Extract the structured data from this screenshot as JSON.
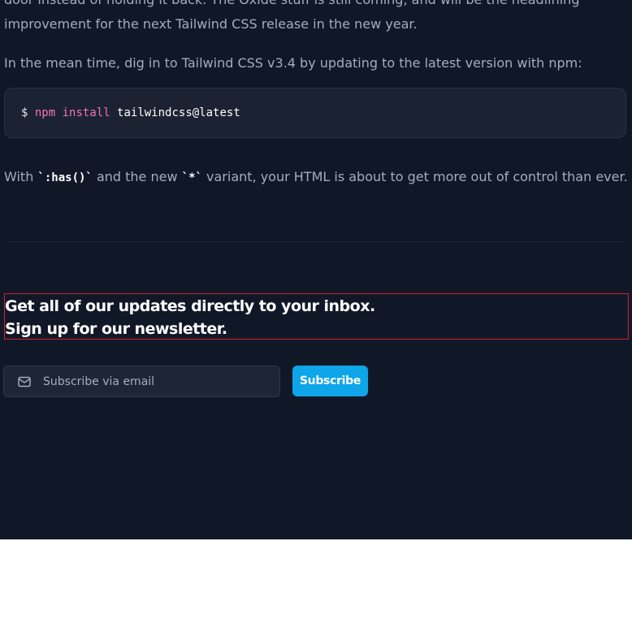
{
  "article": {
    "intro_line1": "door instead of holding it back. The Oxide stuff is still coming, and will be the headlining",
    "intro_line2": "improvement for the next Tailwind CSS release in the new year.",
    "upgrade_text": "In the mean time, dig in to Tailwind CSS v3.4 by updating to the latest version with npm:",
    "code": {
      "prompt": "$",
      "command": "npm install",
      "argument": "tailwindcss@latest"
    },
    "closing": {
      "before": "With ",
      "code1": "`:has()`",
      "middle": " and the new ",
      "code2": "`*`",
      "after": " variant, your HTML is about to get more out of control than ever."
    }
  },
  "newsletter": {
    "heading_line1": "Get all of our updates directly to your inbox.",
    "heading_line2": "Sign up for our newsletter.",
    "email_placeholder": "Subscribe via email",
    "email_value": "",
    "subscribe_label": "Subscribe",
    "mail_icon": "envelope-icon"
  },
  "colors": {
    "background": "#101828",
    "accent": "#0ea5e9",
    "code_command": "#f472b6",
    "body_text": "#a5adbc"
  }
}
